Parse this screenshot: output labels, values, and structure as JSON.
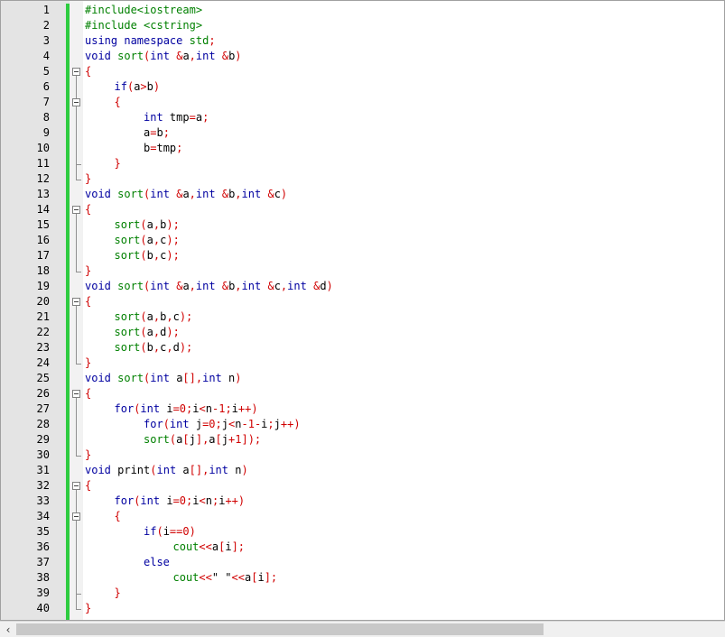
{
  "scrollbar": {
    "left_arrow": "‹",
    "thumb_fraction": 0.75
  },
  "editor": {
    "lines": [
      {
        "n": "1",
        "indent": 0,
        "tokens": [
          [
            "pp",
            "#include<iostream>"
          ]
        ]
      },
      {
        "n": "2",
        "indent": 0,
        "tokens": [
          [
            "pp",
            "#include <cstring>"
          ]
        ]
      },
      {
        "n": "3",
        "indent": 0,
        "tokens": [
          [
            "kw",
            "using"
          ],
          [
            "id",
            " "
          ],
          [
            "kw",
            "namespace"
          ],
          [
            "id",
            " "
          ],
          [
            "pp",
            "std"
          ],
          [
            "op",
            ";"
          ]
        ]
      },
      {
        "n": "4",
        "indent": 0,
        "tokens": [
          [
            "ty",
            "void"
          ],
          [
            "id",
            " "
          ],
          [
            "pp",
            "sort"
          ],
          [
            "op",
            "("
          ],
          [
            "ty",
            "int"
          ],
          [
            "id",
            " "
          ],
          [
            "op",
            "&"
          ],
          [
            "id",
            "a"
          ],
          [
            "op",
            ","
          ],
          [
            "ty",
            "int"
          ],
          [
            "id",
            " "
          ],
          [
            "op",
            "&"
          ],
          [
            "id",
            "b"
          ],
          [
            "op",
            ")"
          ]
        ]
      },
      {
        "n": "5",
        "indent": 0,
        "tokens": [
          [
            "op",
            "{"
          ]
        ]
      },
      {
        "n": "6",
        "indent": 1,
        "tokens": [
          [
            "kw",
            "if"
          ],
          [
            "op",
            "("
          ],
          [
            "id",
            "a"
          ],
          [
            "op",
            ">"
          ],
          [
            "id",
            "b"
          ],
          [
            "op",
            ")"
          ]
        ]
      },
      {
        "n": "7",
        "indent": 1,
        "tokens": [
          [
            "op",
            "{"
          ]
        ]
      },
      {
        "n": "8",
        "indent": 2,
        "tokens": [
          [
            "ty",
            "int"
          ],
          [
            "id",
            " tmp"
          ],
          [
            "op",
            "="
          ],
          [
            "id",
            "a"
          ],
          [
            "op",
            ";"
          ]
        ]
      },
      {
        "n": "9",
        "indent": 2,
        "tokens": [
          [
            "id",
            "a"
          ],
          [
            "op",
            "="
          ],
          [
            "id",
            "b"
          ],
          [
            "op",
            ";"
          ]
        ]
      },
      {
        "n": "10",
        "indent": 2,
        "tokens": [
          [
            "id",
            "b"
          ],
          [
            "op",
            "="
          ],
          [
            "id",
            "tmp"
          ],
          [
            "op",
            ";"
          ]
        ]
      },
      {
        "n": "11",
        "indent": 1,
        "tokens": [
          [
            "op",
            "}"
          ]
        ]
      },
      {
        "n": "12",
        "indent": 0,
        "tokens": [
          [
            "op",
            "}"
          ]
        ]
      },
      {
        "n": "13",
        "indent": 0,
        "tokens": [
          [
            "ty",
            "void"
          ],
          [
            "id",
            " "
          ],
          [
            "pp",
            "sort"
          ],
          [
            "op",
            "("
          ],
          [
            "ty",
            "int"
          ],
          [
            "id",
            " "
          ],
          [
            "op",
            "&"
          ],
          [
            "id",
            "a"
          ],
          [
            "op",
            ","
          ],
          [
            "ty",
            "int"
          ],
          [
            "id",
            " "
          ],
          [
            "op",
            "&"
          ],
          [
            "id",
            "b"
          ],
          [
            "op",
            ","
          ],
          [
            "ty",
            "int"
          ],
          [
            "id",
            " "
          ],
          [
            "op",
            "&"
          ],
          [
            "id",
            "c"
          ],
          [
            "op",
            ")"
          ]
        ]
      },
      {
        "n": "14",
        "indent": 0,
        "tokens": [
          [
            "op",
            "{"
          ]
        ]
      },
      {
        "n": "15",
        "indent": 1,
        "tokens": [
          [
            "pp",
            "sort"
          ],
          [
            "op",
            "("
          ],
          [
            "id",
            "a"
          ],
          [
            "op",
            ","
          ],
          [
            "id",
            "b"
          ],
          [
            "op",
            ");"
          ]
        ]
      },
      {
        "n": "16",
        "indent": 1,
        "tokens": [
          [
            "pp",
            "sort"
          ],
          [
            "op",
            "("
          ],
          [
            "id",
            "a"
          ],
          [
            "op",
            ","
          ],
          [
            "id",
            "c"
          ],
          [
            "op",
            ");"
          ]
        ]
      },
      {
        "n": "17",
        "indent": 1,
        "tokens": [
          [
            "pp",
            "sort"
          ],
          [
            "op",
            "("
          ],
          [
            "id",
            "b"
          ],
          [
            "op",
            ","
          ],
          [
            "id",
            "c"
          ],
          [
            "op",
            ");"
          ]
        ]
      },
      {
        "n": "18",
        "indent": 0,
        "tokens": [
          [
            "op",
            "}"
          ]
        ]
      },
      {
        "n": "19",
        "indent": 0,
        "tokens": [
          [
            "ty",
            "void"
          ],
          [
            "id",
            " "
          ],
          [
            "pp",
            "sort"
          ],
          [
            "op",
            "("
          ],
          [
            "ty",
            "int"
          ],
          [
            "id",
            " "
          ],
          [
            "op",
            "&"
          ],
          [
            "id",
            "a"
          ],
          [
            "op",
            ","
          ],
          [
            "ty",
            "int"
          ],
          [
            "id",
            " "
          ],
          [
            "op",
            "&"
          ],
          [
            "id",
            "b"
          ],
          [
            "op",
            ","
          ],
          [
            "ty",
            "int"
          ],
          [
            "id",
            " "
          ],
          [
            "op",
            "&"
          ],
          [
            "id",
            "c"
          ],
          [
            "op",
            ","
          ],
          [
            "ty",
            "int"
          ],
          [
            "id",
            " "
          ],
          [
            "op",
            "&"
          ],
          [
            "id",
            "d"
          ],
          [
            "op",
            ")"
          ]
        ]
      },
      {
        "n": "20",
        "indent": 0,
        "tokens": [
          [
            "op",
            "{"
          ]
        ]
      },
      {
        "n": "21",
        "indent": 1,
        "tokens": [
          [
            "pp",
            "sort"
          ],
          [
            "op",
            "("
          ],
          [
            "id",
            "a"
          ],
          [
            "op",
            ","
          ],
          [
            "id",
            "b"
          ],
          [
            "op",
            ","
          ],
          [
            "id",
            "c"
          ],
          [
            "op",
            ");"
          ]
        ]
      },
      {
        "n": "22",
        "indent": 1,
        "tokens": [
          [
            "pp",
            "sort"
          ],
          [
            "op",
            "("
          ],
          [
            "id",
            "a"
          ],
          [
            "op",
            ","
          ],
          [
            "id",
            "d"
          ],
          [
            "op",
            ");"
          ]
        ]
      },
      {
        "n": "23",
        "indent": 1,
        "tokens": [
          [
            "pp",
            "sort"
          ],
          [
            "op",
            "("
          ],
          [
            "id",
            "b"
          ],
          [
            "op",
            ","
          ],
          [
            "id",
            "c"
          ],
          [
            "op",
            ","
          ],
          [
            "id",
            "d"
          ],
          [
            "op",
            ");"
          ]
        ]
      },
      {
        "n": "24",
        "indent": 0,
        "tokens": [
          [
            "op",
            "}"
          ]
        ]
      },
      {
        "n": "25",
        "indent": 0,
        "tokens": [
          [
            "ty",
            "void"
          ],
          [
            "id",
            " "
          ],
          [
            "pp",
            "sort"
          ],
          [
            "op",
            "("
          ],
          [
            "ty",
            "int"
          ],
          [
            "id",
            " a"
          ],
          [
            "op",
            "[],"
          ],
          [
            "ty",
            "int"
          ],
          [
            "id",
            " n"
          ],
          [
            "op",
            ")"
          ]
        ]
      },
      {
        "n": "26",
        "indent": 0,
        "tokens": [
          [
            "op",
            "{"
          ]
        ]
      },
      {
        "n": "27",
        "indent": 1,
        "tokens": [
          [
            "kw",
            "for"
          ],
          [
            "op",
            "("
          ],
          [
            "ty",
            "int"
          ],
          [
            "id",
            " i"
          ],
          [
            "op",
            "="
          ],
          [
            "num",
            "0"
          ],
          [
            "op",
            ";"
          ],
          [
            "id",
            "i"
          ],
          [
            "op",
            "<"
          ],
          [
            "id",
            "n"
          ],
          [
            "op",
            "-"
          ],
          [
            "num",
            "1"
          ],
          [
            "op",
            ";"
          ],
          [
            "id",
            "i"
          ],
          [
            "op",
            "++)"
          ]
        ]
      },
      {
        "n": "28",
        "indent": 2,
        "tokens": [
          [
            "kw",
            "for"
          ],
          [
            "op",
            "("
          ],
          [
            "ty",
            "int"
          ],
          [
            "id",
            " j"
          ],
          [
            "op",
            "="
          ],
          [
            "num",
            "0"
          ],
          [
            "op",
            ";"
          ],
          [
            "id",
            "j"
          ],
          [
            "op",
            "<"
          ],
          [
            "id",
            "n"
          ],
          [
            "op",
            "-"
          ],
          [
            "num",
            "1"
          ],
          [
            "op",
            "-"
          ],
          [
            "id",
            "i"
          ],
          [
            "op",
            ";"
          ],
          [
            "id",
            "j"
          ],
          [
            "op",
            "++)"
          ]
        ]
      },
      {
        "n": "29",
        "indent": 2,
        "tokens": [
          [
            "pp",
            "sort"
          ],
          [
            "op",
            "("
          ],
          [
            "id",
            "a"
          ],
          [
            "op",
            "["
          ],
          [
            "id",
            "j"
          ],
          [
            "op",
            "],"
          ],
          [
            "id",
            "a"
          ],
          [
            "op",
            "["
          ],
          [
            "id",
            "j"
          ],
          [
            "op",
            "+"
          ],
          [
            "num",
            "1"
          ],
          [
            "op",
            "]);"
          ]
        ]
      },
      {
        "n": "30",
        "indent": 0,
        "tokens": [
          [
            "op",
            "}"
          ]
        ]
      },
      {
        "n": "31",
        "indent": 0,
        "tokens": [
          [
            "ty",
            "void"
          ],
          [
            "id",
            " print"
          ],
          [
            "op",
            "("
          ],
          [
            "ty",
            "int"
          ],
          [
            "id",
            " a"
          ],
          [
            "op",
            "[],"
          ],
          [
            "ty",
            "int"
          ],
          [
            "id",
            " n"
          ],
          [
            "op",
            ")"
          ]
        ]
      },
      {
        "n": "32",
        "indent": 0,
        "tokens": [
          [
            "op",
            "{"
          ]
        ]
      },
      {
        "n": "33",
        "indent": 1,
        "tokens": [
          [
            "kw",
            "for"
          ],
          [
            "op",
            "("
          ],
          [
            "ty",
            "int"
          ],
          [
            "id",
            " i"
          ],
          [
            "op",
            "="
          ],
          [
            "num",
            "0"
          ],
          [
            "op",
            ";"
          ],
          [
            "id",
            "i"
          ],
          [
            "op",
            "<"
          ],
          [
            "id",
            "n"
          ],
          [
            "op",
            ";"
          ],
          [
            "id",
            "i"
          ],
          [
            "op",
            "++)"
          ]
        ]
      },
      {
        "n": "34",
        "indent": 1,
        "tokens": [
          [
            "op",
            "{"
          ]
        ]
      },
      {
        "n": "35",
        "indent": 2,
        "tokens": [
          [
            "kw",
            "if"
          ],
          [
            "op",
            "("
          ],
          [
            "id",
            "i"
          ],
          [
            "op",
            "=="
          ],
          [
            "num",
            "0"
          ],
          [
            "op",
            ")"
          ]
        ]
      },
      {
        "n": "36",
        "indent": 3,
        "tokens": [
          [
            "pp",
            "cout"
          ],
          [
            "op",
            "<<"
          ],
          [
            "id",
            "a"
          ],
          [
            "op",
            "["
          ],
          [
            "id",
            "i"
          ],
          [
            "op",
            "];"
          ]
        ]
      },
      {
        "n": "37",
        "indent": 2,
        "tokens": [
          [
            "kw",
            "else"
          ]
        ]
      },
      {
        "n": "38",
        "indent": 3,
        "tokens": [
          [
            "pp",
            "cout"
          ],
          [
            "op",
            "<<"
          ],
          [
            "id",
            "\" \""
          ],
          [
            "op",
            "<<"
          ],
          [
            "id",
            "a"
          ],
          [
            "op",
            "["
          ],
          [
            "id",
            "i"
          ],
          [
            "op",
            "];"
          ]
        ]
      },
      {
        "n": "39",
        "indent": 1,
        "tokens": [
          [
            "op",
            "}"
          ]
        ]
      },
      {
        "n": "40",
        "indent": 0,
        "tokens": [
          [
            "op",
            "}"
          ]
        ]
      }
    ]
  }
}
